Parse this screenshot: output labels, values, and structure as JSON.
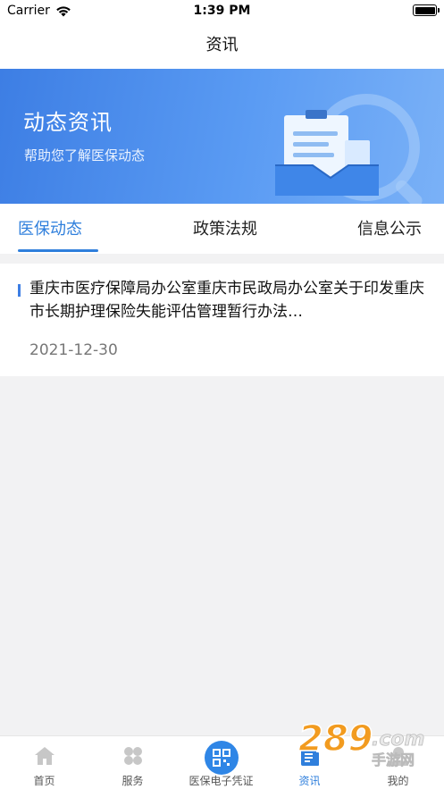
{
  "status_bar": {
    "carrier": "Carrier",
    "time": "1:39 PM",
    "battery_level": 1.0
  },
  "nav": {
    "title": "资讯"
  },
  "banner": {
    "title": "动态资讯",
    "subtitle": "帮助您了解医保动态",
    "colors": {
      "start": "#3d7ee4",
      "end": "#7ab1f7"
    },
    "illustration": "document-tray-magnifier-illustration"
  },
  "tabs": [
    {
      "label": "医保动态",
      "active": true
    },
    {
      "label": "政策法规",
      "active": false
    },
    {
      "label": "信息公示",
      "active": false
    }
  ],
  "news": [
    {
      "title": "重庆市医疗保障局办公室重庆市民政局办公室关于印发重庆市长期护理保险失能评估管理暂行办法…",
      "date": "2021-12-30"
    }
  ],
  "tabbar": {
    "accent": "#2f7fdc",
    "items": [
      {
        "label": "首页",
        "icon": "home-icon",
        "active": false
      },
      {
        "label": "服务",
        "icon": "services-grid-icon",
        "active": false
      },
      {
        "label": "医保电子凭证",
        "icon": "qr-code-icon",
        "active": false
      },
      {
        "label": "资讯",
        "icon": "news-icon",
        "active": true
      },
      {
        "label": "我的",
        "icon": "profile-icon",
        "active": false
      }
    ]
  },
  "watermark": {
    "text_number": "289",
    "text_domain": ".com",
    "text_cn": "手游网"
  }
}
